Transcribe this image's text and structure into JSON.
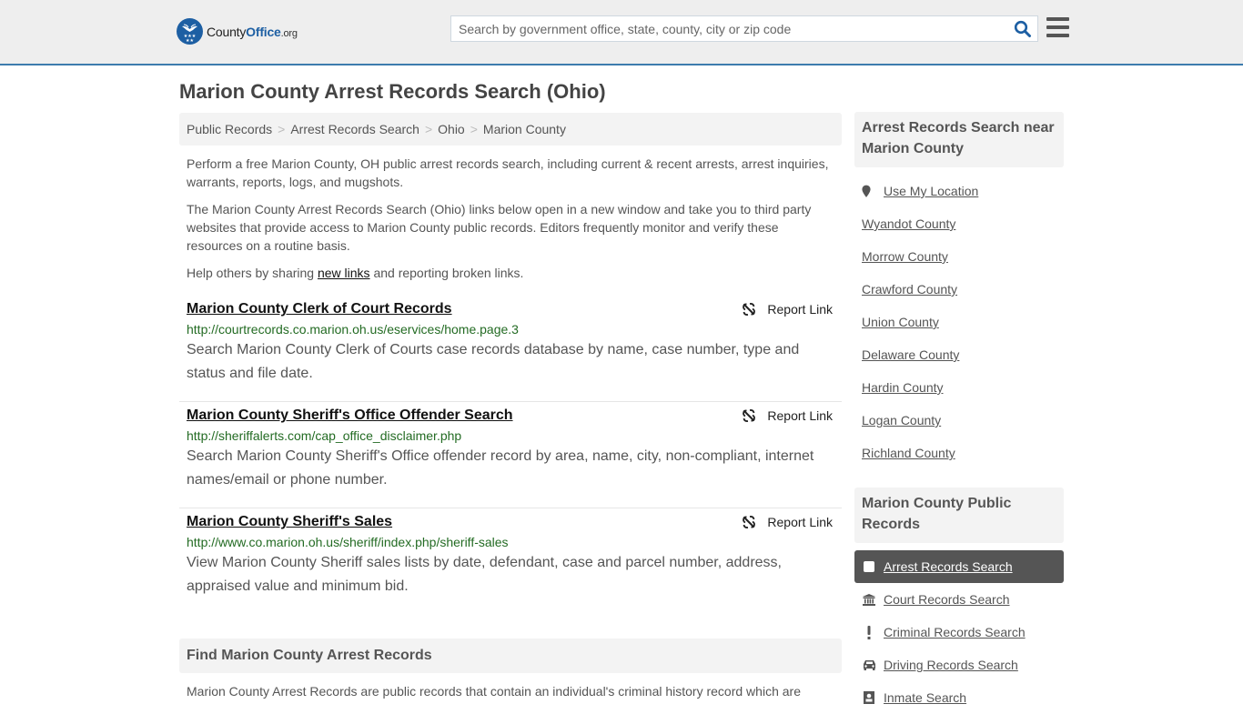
{
  "header": {
    "logo": {
      "text_main": "County",
      "text_brand": "Office",
      "text_tld": ".org"
    },
    "search": {
      "placeholder": "Search by government office, state, county, city or zip code",
      "value": ""
    },
    "icons": {
      "search": "search-icon",
      "menu": "hamburger-menu-icon"
    }
  },
  "page": {
    "title": "Marion County Arrest Records Search (Ohio)",
    "breadcrumb": [
      {
        "label": "Public Records"
      },
      {
        "label": "Arrest Records Search"
      },
      {
        "label": "Ohio"
      },
      {
        "label": "Marion County"
      }
    ],
    "breadcrumb_separator": ">",
    "intro": {
      "p1": "Perform a free Marion County, OH public arrest records search, including current & recent arrests, arrest inquiries, warrants, reports, logs, and mugshots.",
      "p2": "The Marion County Arrest Records Search (Ohio) links below open in a new window and take you to third party websites that provide access to Marion County public records. Editors frequently monitor and verify these resources on a routine basis.",
      "p3_before": "Help others by sharing ",
      "p3_link": "new links",
      "p3_after": " and reporting broken links."
    },
    "report_label": "Report Link",
    "results": [
      {
        "title": "Marion County Clerk of Court Records",
        "url": "http://courtrecords.co.marion.oh.us/eservices/home.page.3",
        "description": "Search Marion County Clerk of Courts case records database by name, case number, type and status and file date."
      },
      {
        "title": "Marion County Sheriff's Office Offender Search",
        "url": "http://sheriffalerts.com/cap_office_disclaimer.php",
        "description": "Search Marion County Sheriff's Office offender record by area, name, city, non-compliant, internet names/email or phone number."
      },
      {
        "title": "Marion County Sheriff's Sales",
        "url": "http://www.co.marion.oh.us/sheriff/index.php/sheriff-sales",
        "description": "View Marion County Sheriff sales lists by date, defendant, case and parcel number, address, appraised value and minimum bid."
      }
    ],
    "find_section": {
      "heading": "Find Marion County Arrest Records",
      "text": "Marion County Arrest Records are public records that contain an individual's criminal history record which are"
    }
  },
  "sidebar": {
    "nearby_heading": "Arrest Records Search near Marion County",
    "use_location": "Use My Location",
    "nearby": [
      "Wyandot County",
      "Morrow County",
      "Crawford County",
      "Union County",
      "Delaware County",
      "Hardin County",
      "Logan County",
      "Richland County"
    ],
    "public_heading": "Marion County Public Records",
    "public_records": [
      {
        "label": "Arrest Records Search",
        "icon": "square-icon",
        "active": true
      },
      {
        "label": "Court Records Search",
        "icon": "courthouse-icon",
        "active": false
      },
      {
        "label": "Criminal Records Search",
        "icon": "exclamation-icon",
        "active": false
      },
      {
        "label": "Driving Records Search",
        "icon": "car-icon",
        "active": false
      },
      {
        "label": "Inmate Search",
        "icon": "inmate-icon",
        "active": false
      }
    ]
  },
  "colors": {
    "header_bg": "#eeeeee",
    "header_border": "#3d7cad",
    "brand_blue": "#1d5fa3",
    "url_green": "#236b23",
    "active_item_bg": "#555555"
  }
}
